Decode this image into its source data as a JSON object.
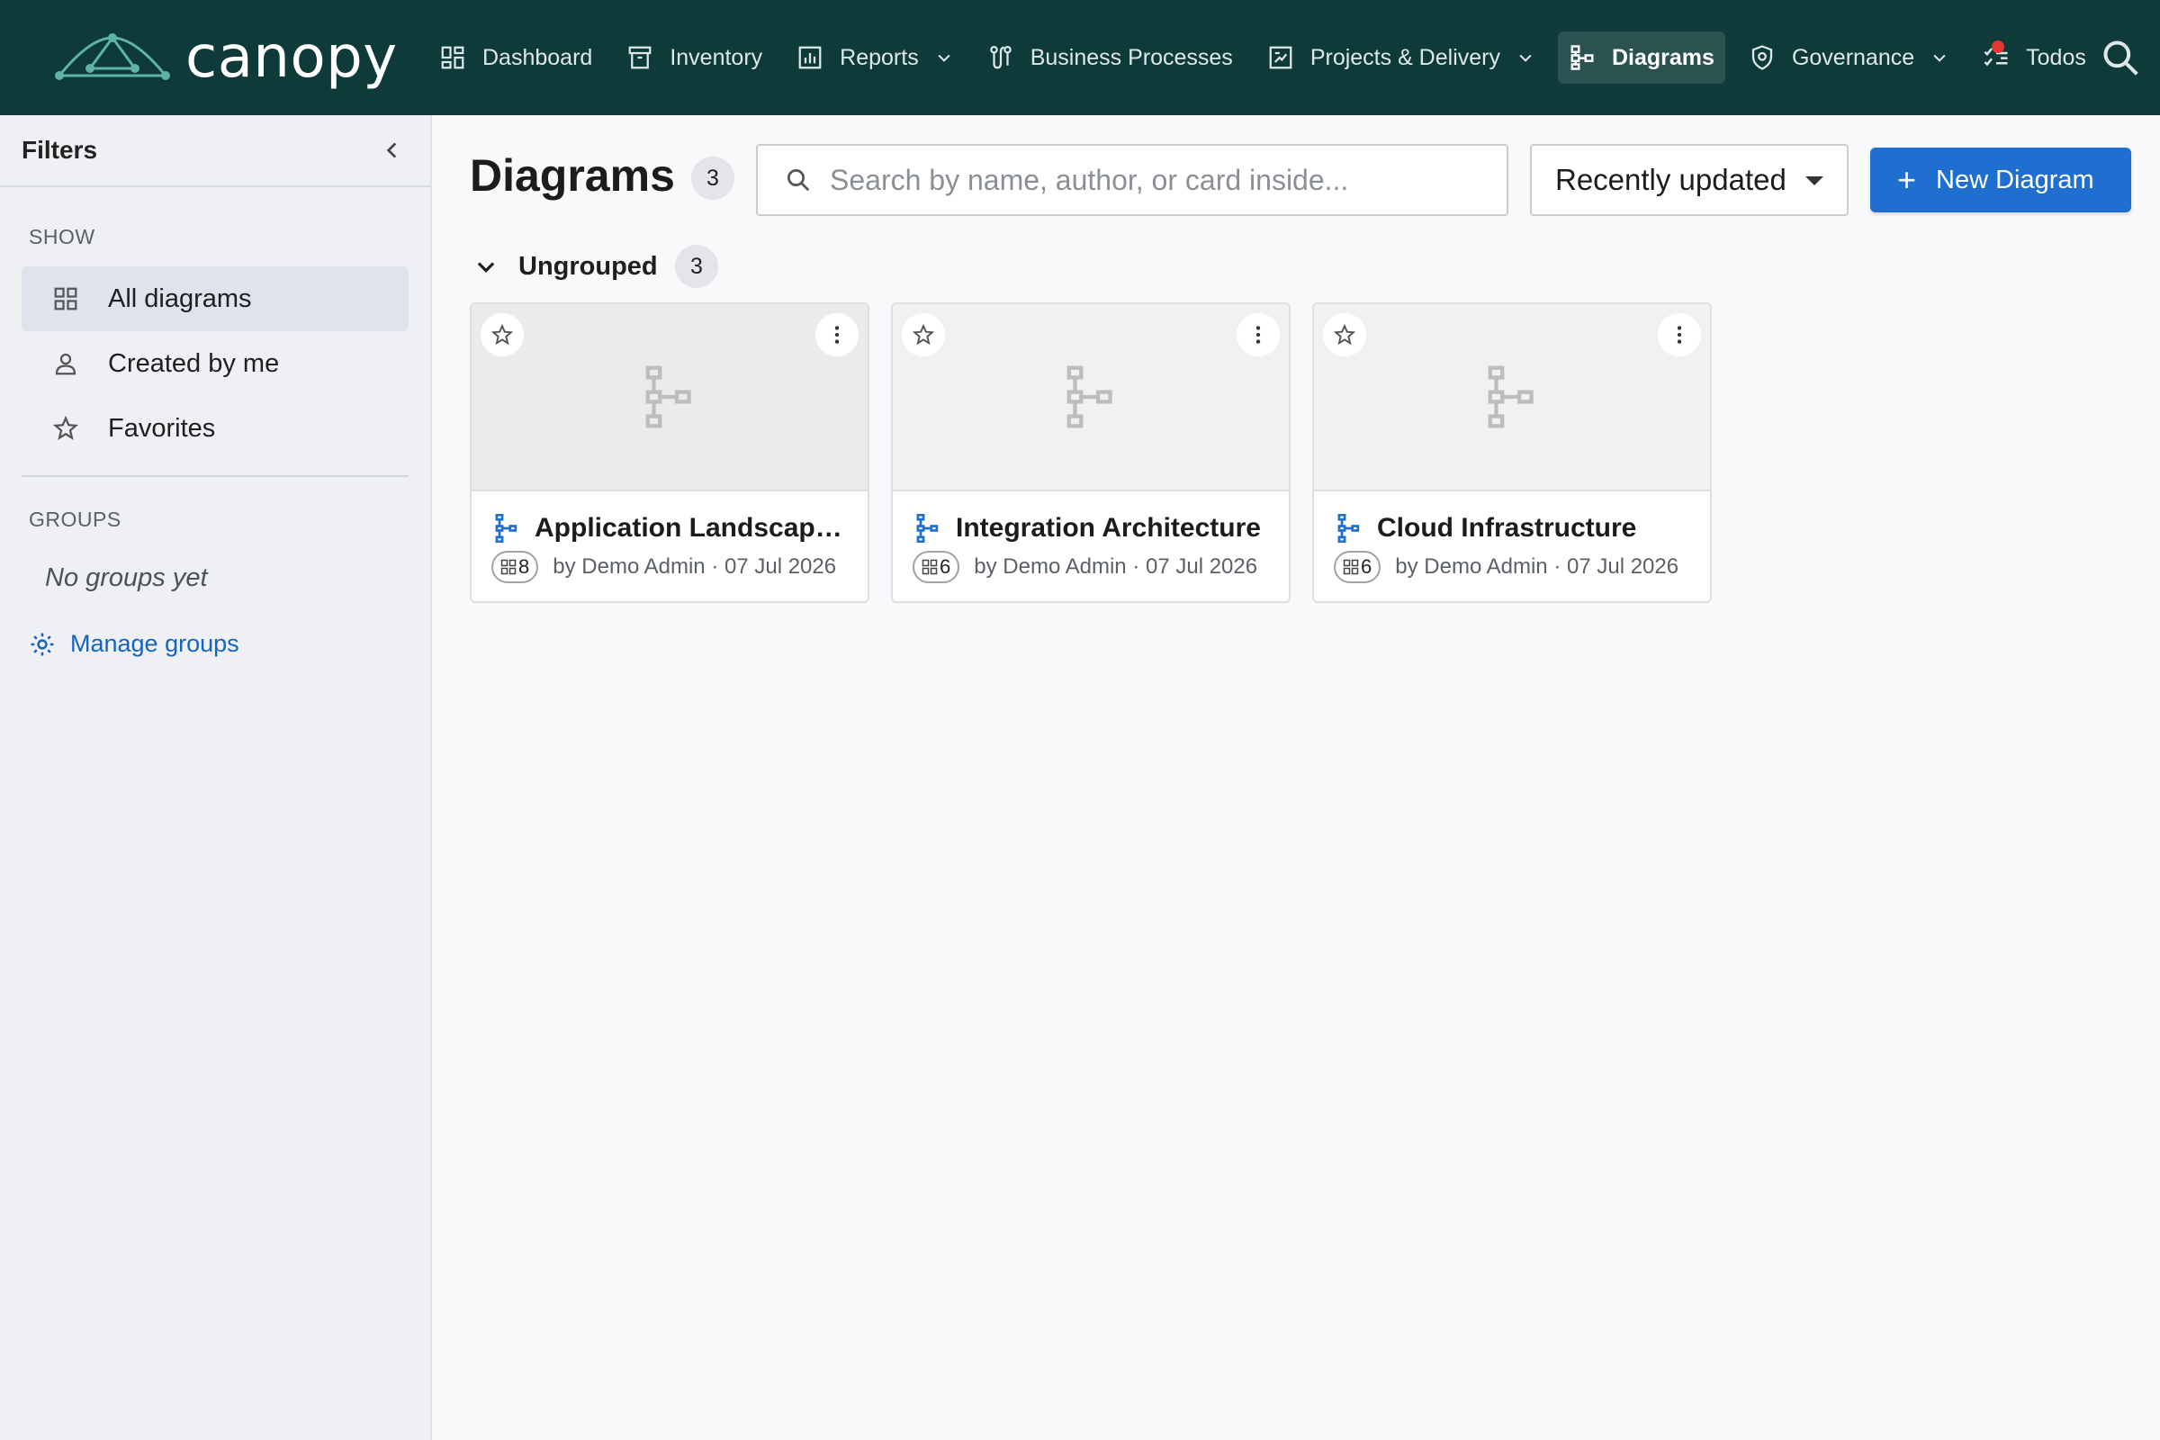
{
  "app": {
    "brand": "canopy",
    "colors": {
      "topbar": "#0f3a3a",
      "accent": "#1e6fd0",
      "link": "#1565c0",
      "notification": "#e5392f"
    }
  },
  "nav": {
    "items": [
      {
        "label": "Dashboard",
        "icon": "dashboard-icon"
      },
      {
        "label": "Inventory",
        "icon": "archive-icon"
      },
      {
        "label": "Reports",
        "icon": "bar-chart-icon",
        "dropdown": true
      },
      {
        "label": "Business Processes",
        "icon": "process-icon"
      },
      {
        "label": "Projects & Delivery",
        "icon": "project-icon",
        "dropdown": true
      },
      {
        "label": "Diagrams",
        "icon": "diagram-icon",
        "active": true
      },
      {
        "label": "Governance",
        "icon": "shield-icon",
        "dropdown": true
      },
      {
        "label": "Todos",
        "icon": "checklist-icon",
        "has_notification": true
      }
    ]
  },
  "sidebar": {
    "title": "Filters",
    "show_label": "SHOW",
    "show_items": [
      {
        "label": "All diagrams",
        "icon": "grid-icon",
        "active": true
      },
      {
        "label": "Created by me",
        "icon": "person-icon"
      },
      {
        "label": "Favorites",
        "icon": "star-icon"
      }
    ],
    "groups_label": "GROUPS",
    "no_groups": "No groups yet",
    "manage_groups": "Manage groups"
  },
  "main": {
    "title": "Diagrams",
    "count": "3",
    "search_placeholder": "Search by name, author, or card inside...",
    "sort_selected": "Recently updated",
    "new_button": "New Diagram",
    "group": {
      "label": "Ungrouped",
      "count": "3"
    },
    "cards": [
      {
        "title": "Application Landscape ...",
        "count": "8",
        "meta": "by Demo Admin · 07 Jul 2026"
      },
      {
        "title": "Integration Architecture",
        "count": "6",
        "meta": "by Demo Admin · 07 Jul 2026"
      },
      {
        "title": "Cloud Infrastructure",
        "count": "6",
        "meta": "by Demo Admin · 07 Jul 2026"
      }
    ]
  }
}
